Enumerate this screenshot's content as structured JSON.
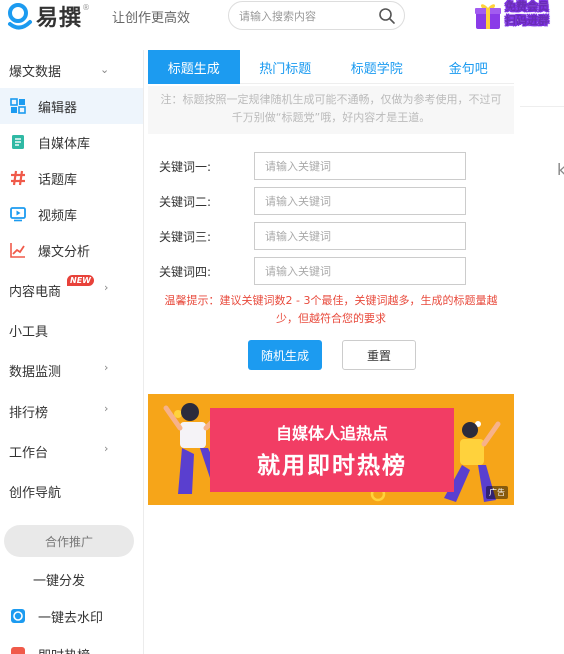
{
  "header": {
    "logo_text": "易撰",
    "logo_mark": "®",
    "slogan": "让创作更高效",
    "search_placeholder": "请输入搜索内容",
    "vip_line1": "免费会员",
    "vip_line2": "扫码进群",
    "colors": {
      "logo_blue": "#1c9bf0",
      "vip_purple": "#7b2ee6"
    }
  },
  "sidebar": {
    "group_viral": "爆文数据",
    "items": [
      {
        "label": "编辑器",
        "icon": "grid-icon",
        "active": true
      },
      {
        "label": "自媒体库",
        "icon": "document-icon"
      },
      {
        "label": "话题库",
        "icon": "hashtag-icon"
      },
      {
        "label": "视频库",
        "icon": "video-icon"
      },
      {
        "label": "爆文分析",
        "icon": "chart-line-icon"
      }
    ],
    "group_ecommerce": "内容电商",
    "new_badge": "NEW",
    "tools": "小工具",
    "monitor": "数据监测",
    "ranking": "排行榜",
    "workbench": "工作台",
    "creation_nav": "创作导航",
    "promo": "合作推广",
    "one_click_publish": "一键分发",
    "watermark_remove": "一键去水印",
    "cut_off_next": "即时热榜"
  },
  "tabs": [
    {
      "label": "标题生成",
      "active": true
    },
    {
      "label": "热门标题"
    },
    {
      "label": "标题学院"
    },
    {
      "label": "金句吧"
    }
  ],
  "notice": "注：标题按照一定规律随机生成可能不通畅，仅做为参考使用，不过可千万别做“标题党”哦，好内容才是王道。",
  "form": {
    "fields": [
      {
        "label": "关键词一:",
        "placeholder": "请输入关键词",
        "value": ""
      },
      {
        "label": "关键词二:",
        "placeholder": "请输入关键词",
        "value": ""
      },
      {
        "label": "关键词三:",
        "placeholder": "请输入关键词",
        "value": ""
      },
      {
        "label": "关键词四:",
        "placeholder": "请输入关键词",
        "value": ""
      }
    ],
    "tip": "温馨提示：建议关键词数2 - 3个最佳，关键词越多，生成的标题量越少，但越符合您的要求",
    "generate_button": "随机生成",
    "reset_button": "重置"
  },
  "ad": {
    "line1": "自媒体人追热点",
    "line2": "就用即时热榜",
    "tag": "广告"
  },
  "right_strip": {
    "glyph": "k"
  }
}
